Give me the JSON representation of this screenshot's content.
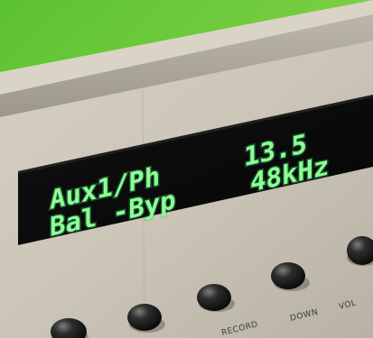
{
  "display": {
    "line1_left": "Aux1/Ph",
    "line1_right": "13.5",
    "line2_left": "Bal -Byp",
    "line2_right": "48kHz"
  },
  "panel_labels": {
    "record": "RECORD",
    "down": "DOWN",
    "vol": "VOL"
  },
  "colors": {
    "display_text": "#8cff96",
    "display_background": "#0b0b0b",
    "panel": "#c9c3b6",
    "background_top": "#6ccc3a"
  }
}
